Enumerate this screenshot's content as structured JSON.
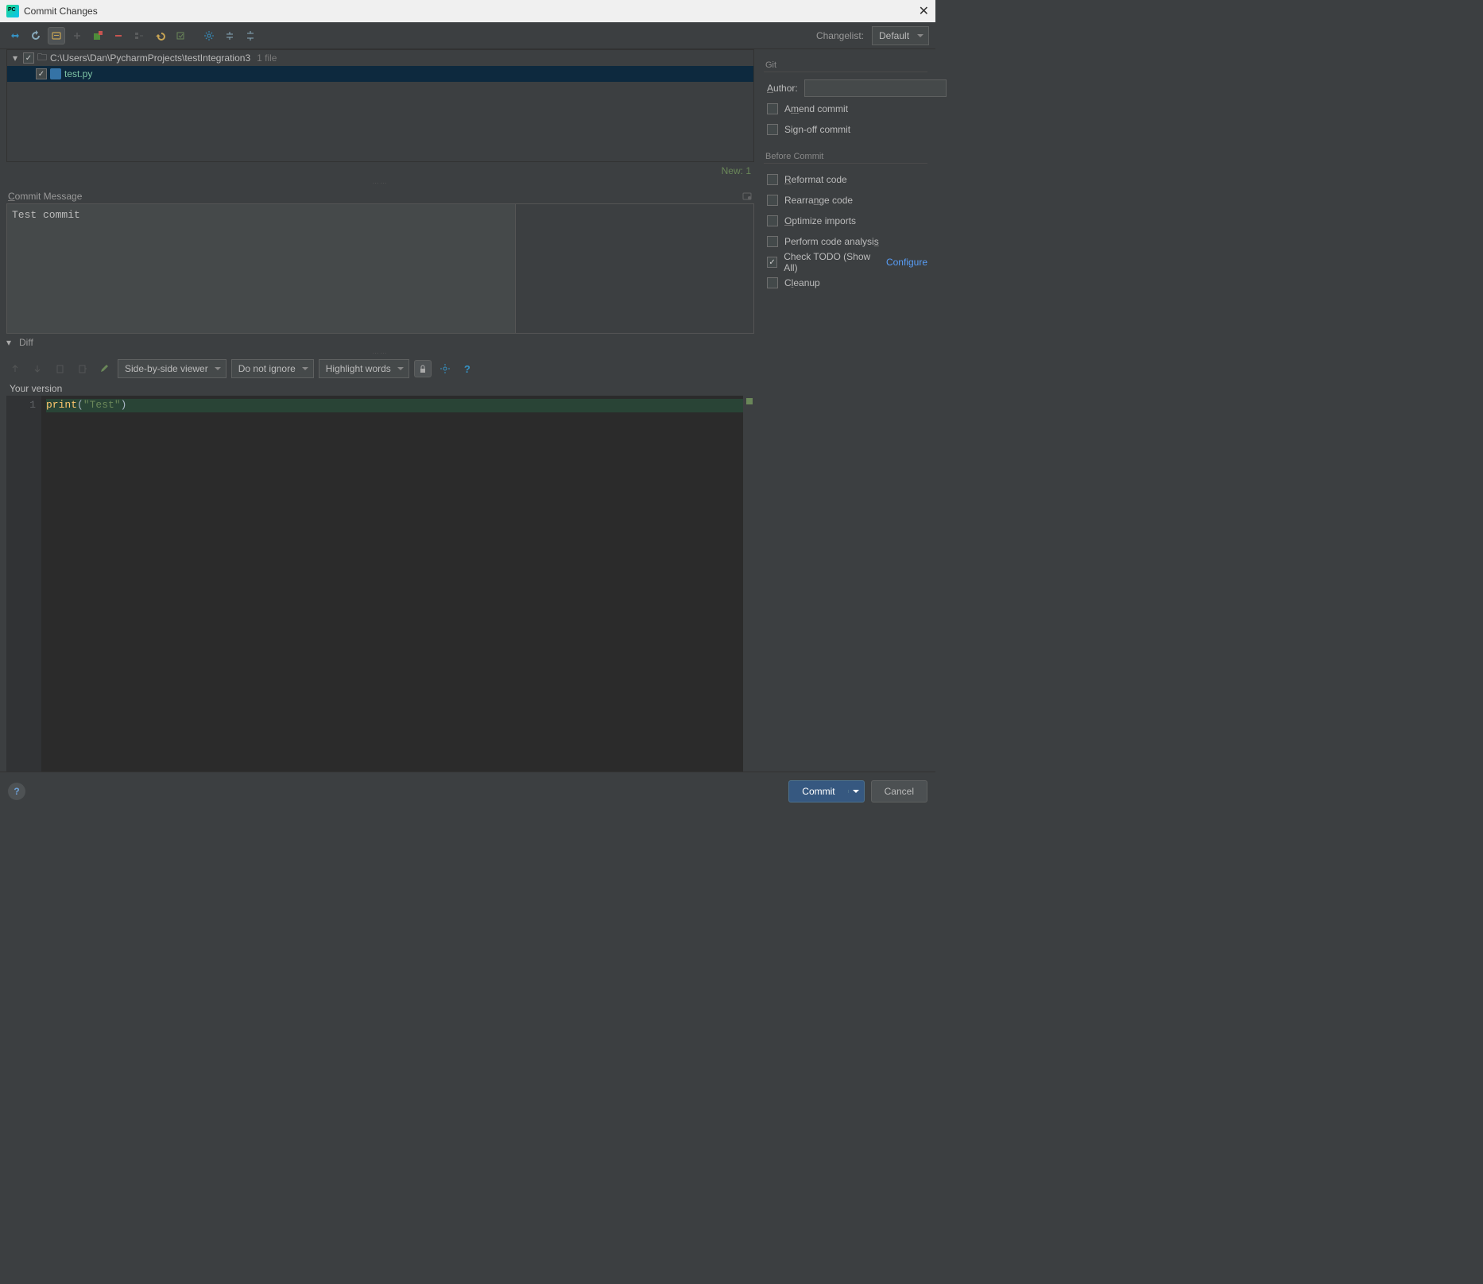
{
  "window": {
    "title": "Commit Changes"
  },
  "toolbar": {
    "changelist_label": "Changelist:",
    "changelist_value": "Default"
  },
  "tree": {
    "root_path": "C:\\Users\\Dan\\PycharmProjects\\testIntegration3",
    "root_count": "1 file",
    "file_name": "test.py"
  },
  "status": {
    "new_count": "New: 1"
  },
  "commit_msg": {
    "label": "Commit Message",
    "value": "Test commit"
  },
  "diff": {
    "label": "Diff",
    "viewer_mode": "Side-by-side viewer",
    "ignore_mode": "Do not ignore",
    "highlight_mode": "Highlight words",
    "your_version": "Your version",
    "line_no": "1",
    "code_fn": "print",
    "code_open": "(",
    "code_str": "\"Test\"",
    "code_close": ")"
  },
  "side": {
    "git_label": "Git",
    "author_label": "Author:",
    "amend": "Amend commit",
    "signoff": "Sign-off commit",
    "before_commit": "Before Commit",
    "reformat": "Reformat code",
    "rearrange": "Rearrange code",
    "optimize": "Optimize imports",
    "analysis": "Perform code analysis",
    "todo": "Check TODO (Show All)",
    "configure": "Configure",
    "cleanup": "Cleanup"
  },
  "footer": {
    "commit": "Commit",
    "cancel": "Cancel"
  }
}
